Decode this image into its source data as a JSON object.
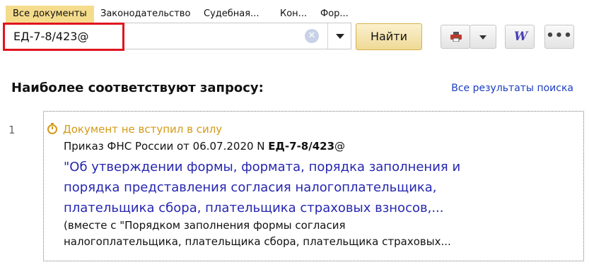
{
  "tabs": [
    {
      "label": "Все документы",
      "active": true
    },
    {
      "label": "Законодательство"
    },
    {
      "label": "Судебная..."
    },
    {
      "label": "Кон..."
    },
    {
      "label": "Фор..."
    }
  ],
  "search": {
    "value": "ЕД-7-8/423@",
    "find_label": "Найти",
    "clear_icon": "clear-icon",
    "dropdown_icon": "chevron-down-icon"
  },
  "toolbar": {
    "print_icon": "printer-icon",
    "word_label": "W",
    "more_label": "•••"
  },
  "results": {
    "heading": "Наиболее соответствуют запросу:",
    "all_results": "Все результаты поиска",
    "items": [
      {
        "number": "1",
        "status": "Документ не вступил в силу",
        "doc_prefix": "Приказ ФНС России от 06.07.2020 N ",
        "doc_number": "ЕД-7-8/423",
        "doc_suffix": "@",
        "title_lines": [
          "\"Об утверждении формы, формата, порядка заполнения и",
          "порядка представления согласия налогоплательщика,",
          "плательщика сбора, плательщика страховых взносов,..."
        ],
        "note_lines": [
          "(вместе с \"Порядком заполнения формы согласия",
          "налогоплательщика, плательщика сбора, плательщика страховых..."
        ]
      }
    ]
  },
  "colors": {
    "active_tab": "#f5dc8c",
    "highlight_border": "#e0141e",
    "status": "#d49a18",
    "link": "#1a3dc0",
    "title": "#2626b0"
  }
}
